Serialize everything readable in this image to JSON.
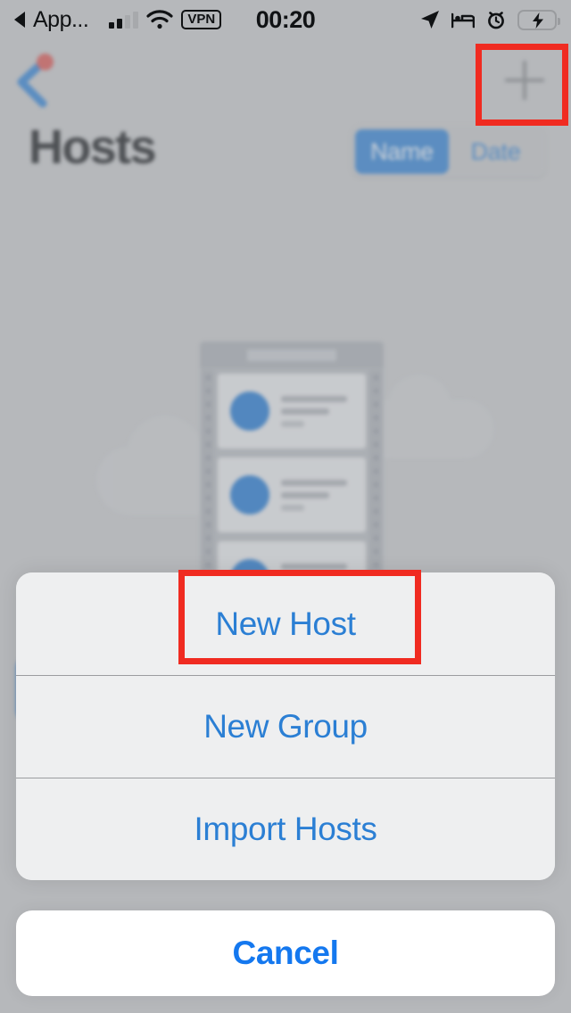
{
  "status_bar": {
    "back_app_label": "App...",
    "back_app_icon": "triangle-left-icon",
    "signal_icon": "cellular-signal-icon",
    "wifi_icon": "wifi-icon",
    "vpn_label": "VPN",
    "time": "00:20",
    "location_icon": "location-arrow-icon",
    "sleep_icon": "bed-icon",
    "alarm_icon": "alarm-clock-icon",
    "battery_icon": "battery-charging-icon",
    "battery_color": "#2ed34b"
  },
  "nav_bar": {
    "back_icon": "chevron-left-icon",
    "back_badge_color": "#d9534f",
    "add_icon": "plus-icon",
    "add_label": "+"
  },
  "title_row": {
    "title": "Hosts",
    "segmented": {
      "options": [
        "Name",
        "Date"
      ],
      "selected": "Name",
      "selected_bg": "#2b7fd4",
      "tint": "#2b7fd4"
    }
  },
  "empty_state": {
    "illustration": "server-rack-illustration",
    "rack_units": 3,
    "accent_color": "#1a74d0",
    "cta_button": "new-host-cta-button"
  },
  "action_sheet": {
    "items": [
      {
        "label": "New Host",
        "name": "new-host"
      },
      {
        "label": "New Group",
        "name": "new-group"
      },
      {
        "label": "Import Hosts",
        "name": "import-hosts"
      }
    ],
    "cancel_label": "Cancel",
    "tint": "#2b7fd4"
  },
  "annotations": {
    "color": "#f02b21",
    "highlighted": [
      "add-button",
      "new-host-item"
    ]
  }
}
